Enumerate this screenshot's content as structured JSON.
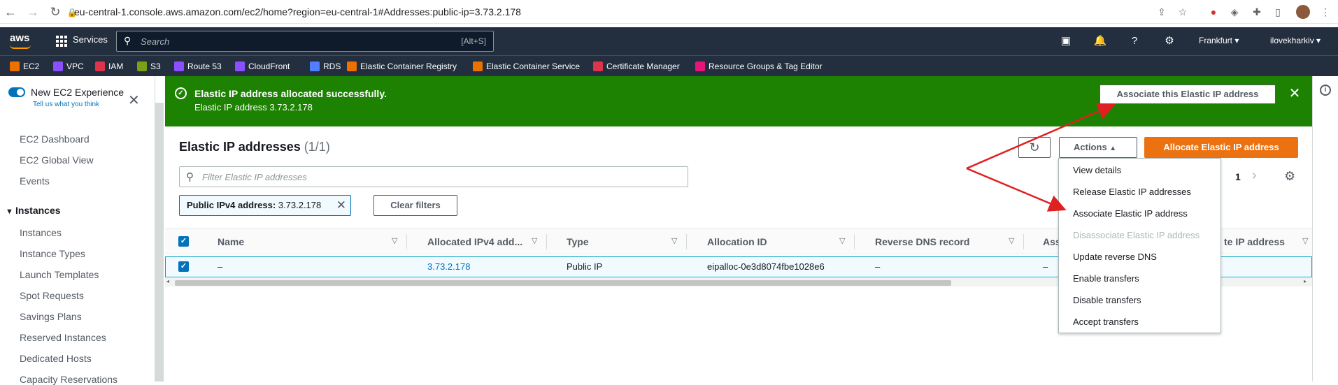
{
  "browser": {
    "url": "eu-central-1.console.aws.amazon.com/ec2/home?region=eu-central-1#Addresses:public-ip=3.73.2.178"
  },
  "topnav": {
    "logo": "aws",
    "services": "Services",
    "search_placeholder": "Search",
    "search_shortcut": "[Alt+S]",
    "region": "Frankfurt",
    "account": "ilovekharkiv"
  },
  "favorites": [
    {
      "label": "EC2",
      "color": "#ed7100"
    },
    {
      "label": "VPC",
      "color": "#8c4fff"
    },
    {
      "label": "IAM",
      "color": "#dd344c"
    },
    {
      "label": "S3",
      "color": "#7aa116"
    },
    {
      "label": "Route 53",
      "color": "#8c4fff"
    },
    {
      "label": "CloudFront",
      "color": "#8c4fff"
    },
    {
      "label": "RDS",
      "color": "#527fff"
    },
    {
      "label": "Elastic Container Registry",
      "color": "#ed7100"
    },
    {
      "label": "Elastic Container Service",
      "color": "#ed7100"
    },
    {
      "label": "Certificate Manager",
      "color": "#dd344c"
    },
    {
      "label": "Resource Groups & Tag Editor",
      "color": "#e7157b"
    }
  ],
  "sidebar": {
    "new_experience": "New EC2 Experience",
    "tell_us": "Tell us what you think",
    "links": [
      "EC2 Dashboard",
      "EC2 Global View",
      "Events"
    ],
    "section": "Instances",
    "items": [
      "Instances",
      "Instance Types",
      "Launch Templates",
      "Spot Requests",
      "Savings Plans",
      "Reserved Instances",
      "Dedicated Hosts",
      "Capacity Reservations"
    ]
  },
  "flash": {
    "title": "Elastic IP address allocated successfully.",
    "message": "Elastic IP address 3.73.2.178",
    "action": "Associate this Elastic IP address"
  },
  "main": {
    "title": "Elastic IP addresses",
    "count": "(1/1)",
    "actions_label": "Actions",
    "allocate_label": "Allocate Elastic IP address",
    "filter_placeholder": "Filter Elastic IP addresses",
    "token_key": "Public IPv4 address:",
    "token_value": "3.73.2.178",
    "clear_filters": "Clear filters",
    "page": "1"
  },
  "table": {
    "headers": [
      "Name",
      "Allocated IPv4 add...",
      "Type",
      "Allocation ID",
      "Reverse DNS record",
      "Ass",
      "te IP address"
    ],
    "row": {
      "name": "–",
      "ip": "3.73.2.178",
      "type": "Public IP",
      "allocation_id": "eipalloc-0e3d8074fbe1028e6",
      "reverse_dns": "–",
      "assoc": "–"
    }
  },
  "actions_menu": [
    {
      "label": "View details",
      "enabled": true
    },
    {
      "label": "Release Elastic IP addresses",
      "enabled": true
    },
    {
      "label": "Associate Elastic IP address",
      "enabled": true
    },
    {
      "label": "Disassociate Elastic IP address",
      "enabled": false
    },
    {
      "label": "Update reverse DNS",
      "enabled": true
    },
    {
      "label": "Enable transfers",
      "enabled": true
    },
    {
      "label": "Disable transfers",
      "enabled": true
    },
    {
      "label": "Accept transfers",
      "enabled": true
    }
  ],
  "colors": {
    "success": "#1d8102",
    "primary": "#ec7211",
    "link": "#0073bb",
    "nav": "#232f3e",
    "annotation": "#e02020"
  }
}
